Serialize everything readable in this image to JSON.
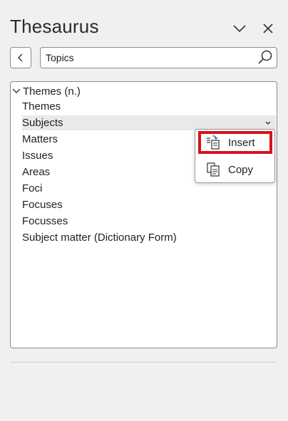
{
  "pane": {
    "title": "Thesaurus",
    "options_icon": "chevron-down-icon",
    "close_icon": "close-icon"
  },
  "search": {
    "value": "Topics",
    "back_icon": "chevron-left-icon",
    "search_icon": "search-icon"
  },
  "results": {
    "group_label": "Themes (n.)",
    "items": [
      "Themes",
      "Subjects",
      "Matters",
      "Issues",
      "Areas",
      "Foci",
      "Focuses",
      "Focusses",
      "Subject matter (Dictionary Form)"
    ],
    "selected": "Subjects"
  },
  "context_menu": {
    "insert_first": "",
    "insert_label": "Insert",
    "copy_label": "Copy",
    "highlight_color": "#d7121b"
  }
}
